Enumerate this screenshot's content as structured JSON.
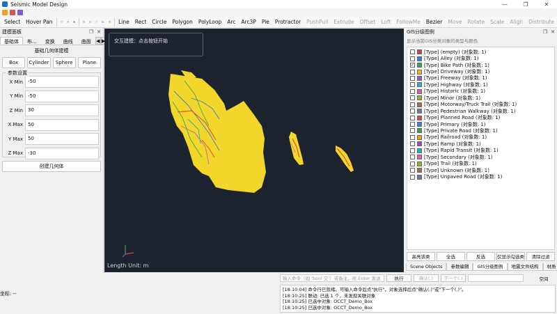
{
  "app": {
    "title": "Seismic Model Design"
  },
  "window_controls": [
    "—",
    "❐",
    "✕"
  ],
  "toolbar": {
    "select": "Select",
    "hover_pan": "Hover Pan",
    "items": [
      "Line",
      "Rect",
      "Circle",
      "Polygon",
      "PolyLoop",
      "Arc",
      "Arc3P",
      "Pie",
      "Protractor"
    ],
    "disabled_items": [
      "PushPull",
      "Extrude",
      "Offset",
      "Loft",
      "FollowMe"
    ],
    "bezier": "Bezier",
    "transform_items": [
      "Move",
      "Rotate",
      "Scale",
      "Align",
      "Distribute"
    ]
  },
  "left_panel": {
    "title": "建模面板",
    "tabs": [
      "基础体",
      "布...",
      "变换",
      "曲线",
      "曲面"
    ],
    "section_title": "基础几何体建模",
    "shape_buttons": [
      "Box",
      "Cylinder",
      "Sphere",
      "Plane"
    ],
    "params_title": "参数设置",
    "params": [
      {
        "label": "X Min",
        "value": "-50"
      },
      {
        "label": "Y Min",
        "value": "-50"
      },
      {
        "label": "Z Min",
        "value": "30"
      },
      {
        "label": "X Max",
        "value": "50"
      },
      {
        "label": "Y Max",
        "value": "50"
      },
      {
        "label": "Z Max",
        "value": "-30"
      }
    ],
    "create_button": "创建几何体"
  },
  "viewport": {
    "hint": "交互建模：点击按钮开始",
    "length_unit": "Length Unit: m",
    "background": "#1e2330",
    "map_colors": [
      "#f2d72a",
      "#3a78d8",
      "#e03b3b",
      "#35a852",
      "#c060c0"
    ]
  },
  "right_panel": {
    "title": "GIS分级图例",
    "subtitle": "显示当前GIS分类对象的类型与颜色",
    "items": [
      {
        "label": "[Type] (empty)  (对象数: 1)",
        "color": "#e03b3b",
        "checked": false
      },
      {
        "label": "[Type] Alley  (对象数: 1)",
        "color": "#3b78e0",
        "checked": false
      },
      {
        "label": "[Type] Bike Path  (对象数: 1)",
        "color": "#2fa84f",
        "checked": true
      },
      {
        "label": "[Type] Driveway  (对象数: 1)",
        "color": "#f0b429",
        "checked": false
      },
      {
        "label": "[Type] Freeway  (对象数: 1)",
        "color": "#9a55c8",
        "checked": false
      },
      {
        "label": "[Type] Highway  (对象数: 1)",
        "color": "#1fb5b0",
        "checked": false
      },
      {
        "label": "[Type] Historic  (对象数: 1)",
        "color": "#e05ca8",
        "checked": false
      },
      {
        "label": "[Type] Minor  (对象数: 1)",
        "color": "#9ab03a",
        "checked": false
      },
      {
        "label": "[Type] Motorway/Truck Trail  (对象数: 1)",
        "color": "#a0724a",
        "checked": false
      },
      {
        "label": "[Type] Pedestrian Walkway  (对象数: 1)",
        "color": "#6a7fa0",
        "checked": false
      },
      {
        "label": "[Type] Planned Road  (对象数: 1)",
        "color": "#e04848",
        "checked": false
      },
      {
        "label": "[Type] Primary  (对象数: 1)",
        "color": "#3b7de0",
        "checked": false
      },
      {
        "label": "[Type] Private Road  (对象数: 1)",
        "color": "#2ea84e",
        "checked": false
      },
      {
        "label": "[Type] Railroad  (对象数: 1)",
        "color": "#f0a020",
        "checked": false
      },
      {
        "label": "[Type] Ramp  (对象数: 1)",
        "color": "#8e4cc0",
        "checked": false
      },
      {
        "label": "[Type] Rapid Transit  (对象数: 1)",
        "color": "#20b0b8",
        "checked": false
      },
      {
        "label": "[Type] Secondary  (对象数: 1)",
        "color": "#e060a8",
        "checked": false
      },
      {
        "label": "[Type] Trail  (对象数: 1)",
        "color": "#98b036",
        "checked": false
      },
      {
        "label": "[Type] Unknown  (对象数: 1)",
        "color": "#a87048",
        "checked": false
      },
      {
        "label": "[Type] Unpaved Road  (对象数: 1)",
        "color": "#6878a0",
        "checked": false
      }
    ],
    "buttons": [
      "高亮该类",
      "全选",
      "反选",
      "仅显示勾选类",
      "清除过滤"
    ],
    "bottom_tabs": [
      "Scene Objects",
      "参数编辑",
      "GIS分级图例",
      "地震文件结构",
      "材质"
    ]
  },
  "status": {
    "coords_label": "坐标: --"
  },
  "console": {
    "placeholder": "输入命令（如 'bool 交'）或备注，按 Enter 发送",
    "run": "执行",
    "confirm": "确认(.)",
    "next": "下一个(.)",
    "clear": "空间",
    "log": [
      "[18:10:04] 命令行已就绪。可输入命令后点\"执行\"，对象选择后点\"确认(.)\"或\"下一个(.)\"。",
      "[18:10:25] 联动: 已选 1 个，未发现关联对象",
      "[18:10:25] 已选中对象: OCCT_Demo_Box",
      "[18:10:25] 已选中对象: OCCT_Demo_Box"
    ]
  }
}
